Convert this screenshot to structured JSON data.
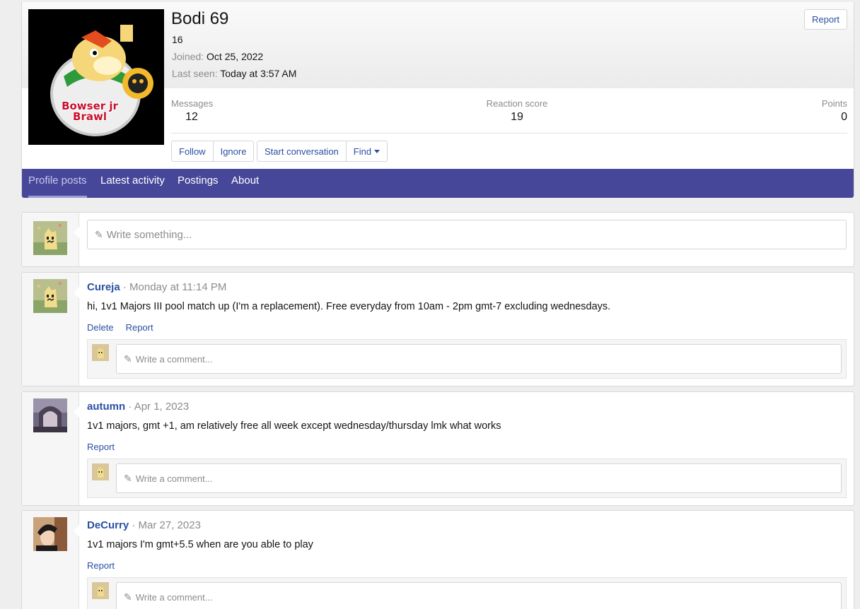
{
  "profile": {
    "username": "Bodi 69",
    "user_title": "16",
    "joined_label": "Joined:",
    "joined_value": "Oct 25, 2022",
    "last_seen_label": "Last seen:",
    "last_seen_value": "Today at 3:57 AM",
    "report_label": "Report",
    "avatar_caption": "Bowser jr Brawl",
    "stats": [
      {
        "label": "Messages",
        "value": "12"
      },
      {
        "label": "Reaction score",
        "value": "19"
      },
      {
        "label": "Points",
        "value": "0"
      }
    ],
    "buttons": {
      "follow": "Follow",
      "ignore": "Ignore",
      "start_conversation": "Start conversation",
      "find": "Find"
    }
  },
  "tabs": [
    {
      "label": "Profile posts",
      "active": true
    },
    {
      "label": "Latest activity",
      "active": false
    },
    {
      "label": "Postings",
      "active": false
    },
    {
      "label": "About",
      "active": false
    }
  ],
  "composer": {
    "placeholder": "Write something..."
  },
  "comment_placeholder": "Write a comment...",
  "posts": [
    {
      "author": "Cureja",
      "date": "Monday at 11:14 PM",
      "body": "hi, 1v1 Majors III pool match up (I'm a replacement). Free everyday from 10am - 2pm gmt-7 excluding wednesdays.",
      "actions": [
        "Delete",
        "Report"
      ]
    },
    {
      "author": "autumn",
      "date": "Apr 1, 2023",
      "body": "1v1 majors, gmt +1, am relatively free all week except wednesday/thursday lmk what works",
      "actions": [
        "Report"
      ]
    },
    {
      "author": "DeCurry",
      "date": "Mar 27, 2023",
      "body": "1v1 majors I'm gmt+5.5 when are you able to play",
      "actions": [
        "Report"
      ]
    }
  ],
  "colors": {
    "tab_bar": "#47479a",
    "link": "#2a4fa3",
    "muted": "#8c8c8c"
  }
}
